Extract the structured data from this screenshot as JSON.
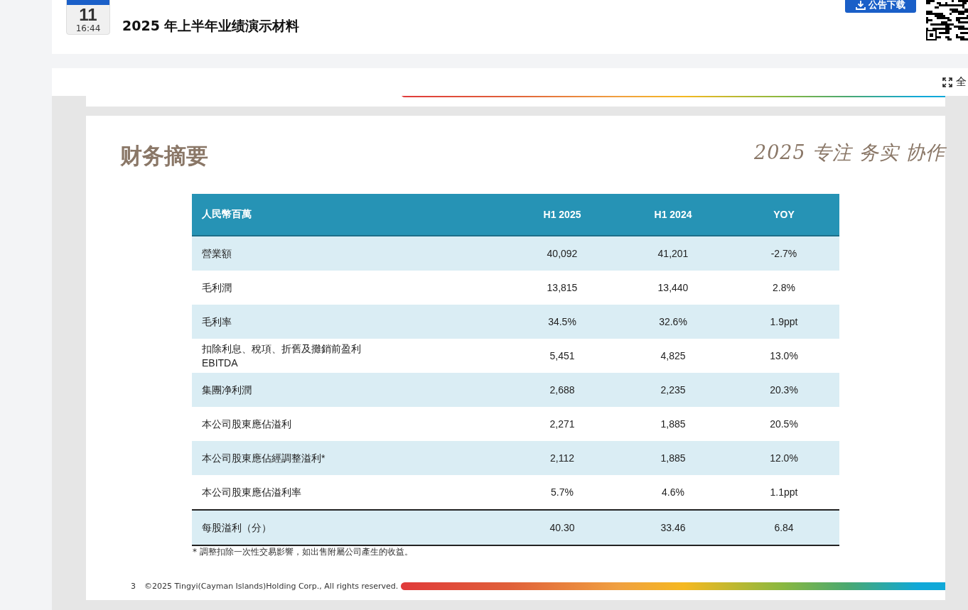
{
  "header": {
    "date_day": "11",
    "date_time": "16:44",
    "title": "2025 年上半年业绩演示材料",
    "download_button": "公告下载"
  },
  "toolbar": {
    "fullscreen_label": "全"
  },
  "slide": {
    "title": "财务摘要",
    "slogan": "2025 专注 务实 协作",
    "table": {
      "columns": [
        "人民幣百萬",
        "H1 2025",
        "H1 2024",
        "YOY"
      ],
      "rows": [
        {
          "cells": [
            "營業額",
            "40,092",
            "41,201",
            "-2.7%"
          ],
          "shaded": true
        },
        {
          "cells": [
            "毛利潤",
            "13,815",
            "13,440",
            "2.8%"
          ],
          "shaded": false
        },
        {
          "cells": [
            "毛利率",
            "34.5%",
            "32.6%",
            "1.9ppt"
          ],
          "shaded": true
        },
        {
          "cells": [
            "扣除利息、稅項、折舊及攤銷前盈利\nEBITDA",
            "5,451",
            "4,825",
            "13.0%"
          ],
          "shaded": false
        },
        {
          "cells": [
            "集團净利潤",
            "2,688",
            "2,235",
            "20.3%"
          ],
          "shaded": true
        },
        {
          "cells": [
            "本公司股東應佔溢利",
            "2,271",
            "1,885",
            "20.5%"
          ],
          "shaded": false
        },
        {
          "cells": [
            "本公司股東應佔經調整溢利*",
            "2,112",
            "1,885",
            "12.0%"
          ],
          "shaded": true
        },
        {
          "cells": [
            "本公司股東應佔溢利率",
            "5.7%",
            "4.6%",
            "1.1ppt"
          ],
          "shaded": false
        },
        {
          "cells": [
            "每股溢利（分）",
            "40.30",
            "33.46",
            "6.84"
          ],
          "shaded": true
        }
      ]
    },
    "footnote": "* 調整扣除一次性交易影響，如出售附屬公司產生的收益。",
    "page": "3",
    "copyright": "©2025 Tingyi(Cayman Islands)Holding Corp., All rights reserved."
  }
}
